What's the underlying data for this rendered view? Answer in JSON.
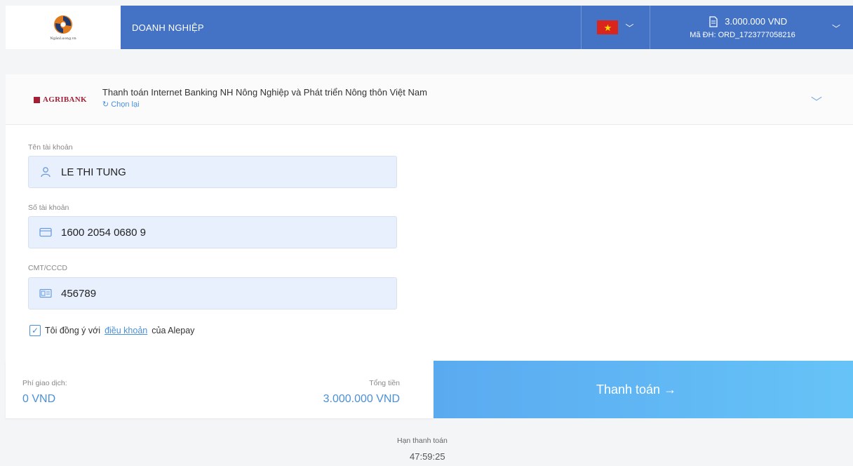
{
  "header": {
    "logo_text": "NgânLuong.vn",
    "company": "DOANH NGHIỆP",
    "amount": "3.000.000 VND",
    "order_label": "Mã ĐH: ORD_1723777058216"
  },
  "bank": {
    "logo_text": "AGRIBANK",
    "title": "Thanh toán Internet Banking NH Nông Nghiệp và Phát triển Nông thôn Việt Nam",
    "reset": "Chọn lại"
  },
  "form": {
    "account_name_label": "Tên tài khoản",
    "account_name": "LE THI TUNG",
    "account_number_label": "Số tài khoản",
    "account_number": "1600 2054 0680 9",
    "id_label": "CMT/CCCD",
    "id_value": "456789",
    "agree_prefix": "Tôi đồng ý với",
    "agree_link": "điều khoản",
    "agree_suffix": "của Alepay",
    "agree_checked": true
  },
  "summary": {
    "fee_label": "Phí giao dịch:",
    "fee_value": "0 VND",
    "total_label": "Tổng tiền",
    "total_value": "3.000.000 VND",
    "pay_label": "Thanh toán →"
  },
  "deadline": {
    "label": "Hạn thanh toán",
    "value": "47:59:25"
  },
  "colors": {
    "header": "#4472c4",
    "accent": "#4a90d9",
    "pay_button": "#5aaaf0",
    "input_bg": "#e8f0fe"
  }
}
